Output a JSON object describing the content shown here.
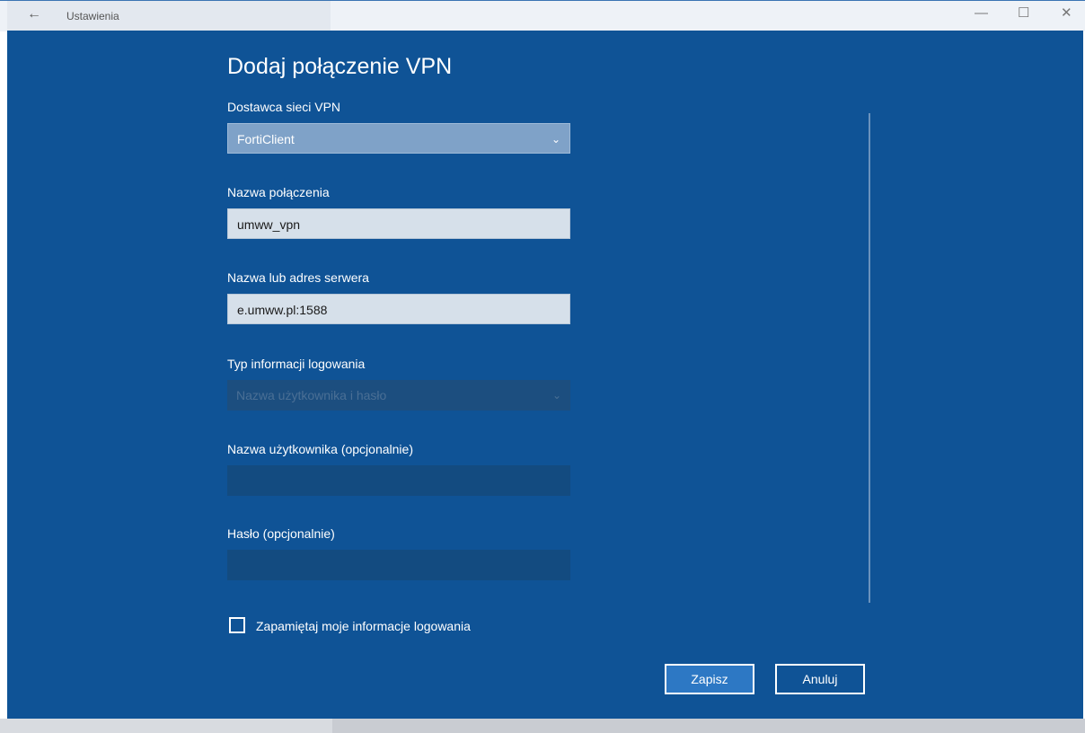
{
  "titlebar": {
    "back_icon": "arrow-left-icon",
    "title": "Ustawienia",
    "minimize_glyph": "—",
    "maximize_glyph": "☐",
    "close_glyph": "✕"
  },
  "dialog": {
    "heading": "Dodaj połączenie VPN",
    "provider": {
      "label": "Dostawca sieci VPN",
      "value": "FortiClient"
    },
    "connection_name": {
      "label": "Nazwa połączenia",
      "value": "umww_vpn"
    },
    "server": {
      "label": "Nazwa lub adres serwera",
      "value": "e.umww.pl:1588"
    },
    "signin_type": {
      "label": "Typ informacji logowania",
      "value": "Nazwa użytkownika i hasło"
    },
    "username": {
      "label": "Nazwa użytkownika (opcjonalnie)",
      "value": ""
    },
    "password": {
      "label": "Hasło (opcjonalnie)",
      "value": ""
    },
    "remember": {
      "label": "Zapamiętaj moje informacje logowania",
      "checked": false
    },
    "save_label": "Zapisz",
    "cancel_label": "Anuluj"
  },
  "colors": {
    "dialog_bg": "#0f5396",
    "primary_button": "#2d78c4"
  }
}
